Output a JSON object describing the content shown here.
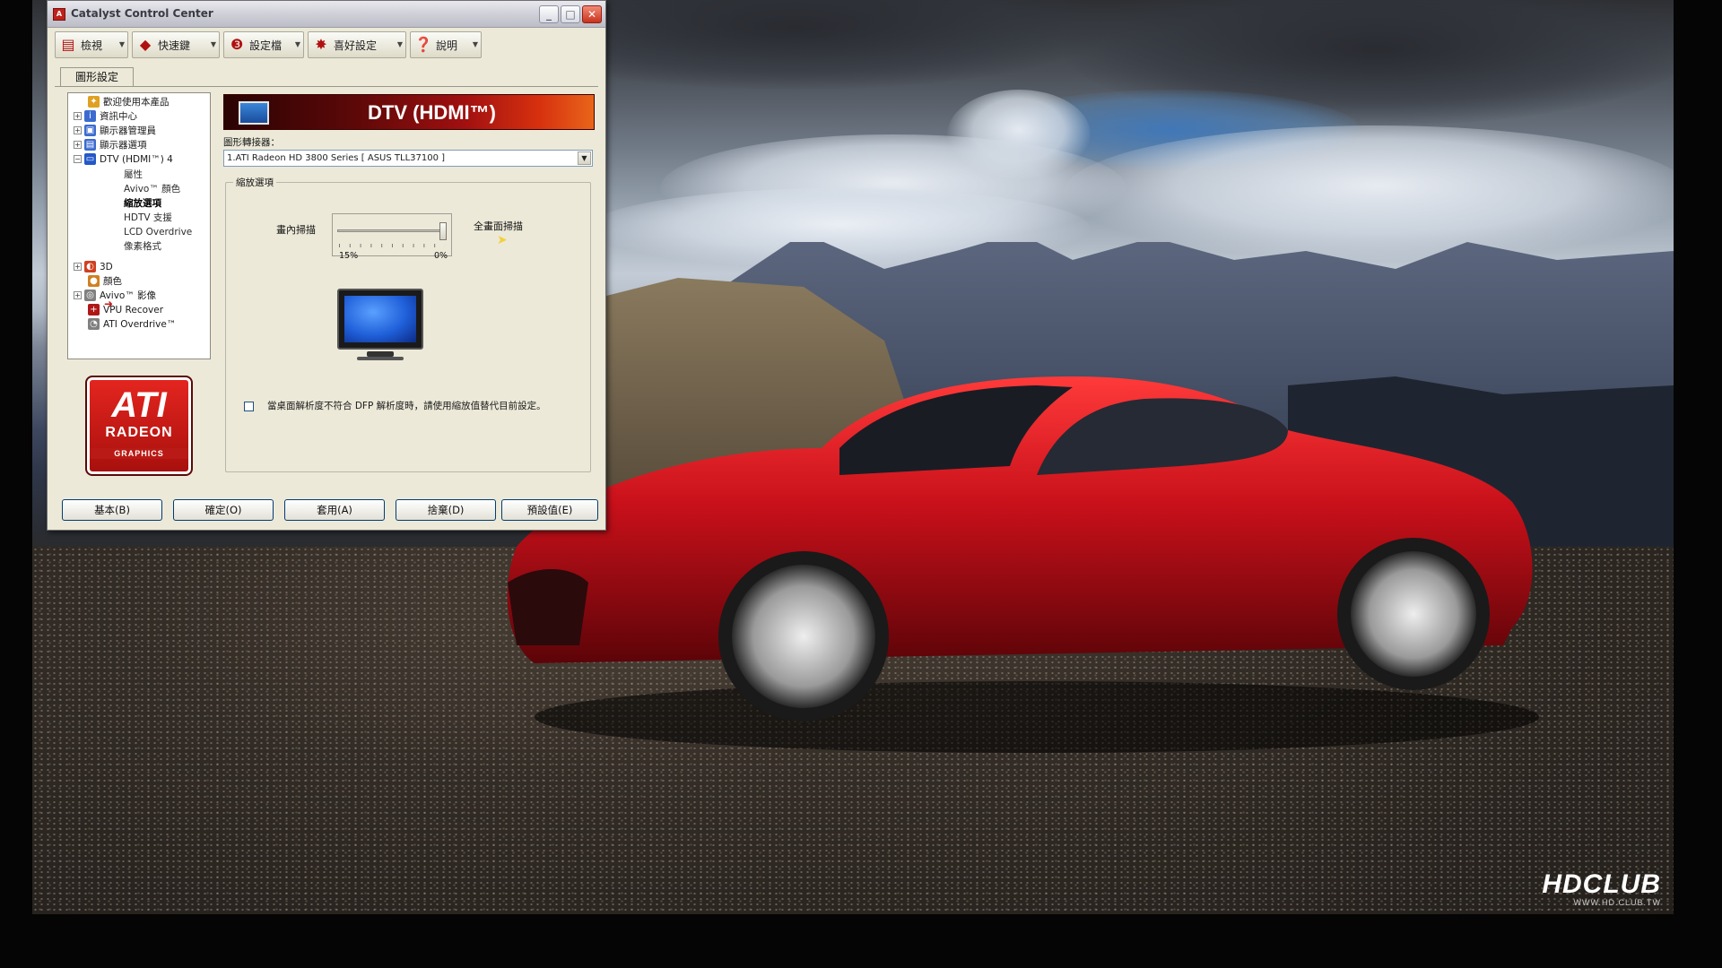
{
  "window": {
    "title": "Catalyst Control Center",
    "minimize": "_",
    "maximize": "□",
    "close": "✕"
  },
  "toolbar": {
    "items": [
      {
        "label": "檢視",
        "icon": "view-icon"
      },
      {
        "label": "快速鍵",
        "icon": "hotkeys-icon"
      },
      {
        "label": "設定檔",
        "icon": "profiles-icon"
      },
      {
        "label": "喜好設定",
        "icon": "preferences-icon"
      },
      {
        "label": "說明",
        "icon": "help-icon"
      }
    ]
  },
  "tabs": {
    "graphics": "圖形設定"
  },
  "tree": {
    "items": [
      {
        "label": "歡迎使用本產品",
        "color": "#e0a020"
      },
      {
        "label": "資訊中心",
        "color": "#3b6bd0"
      },
      {
        "label": "顯示器管理員",
        "color": "#3b6bd0"
      },
      {
        "label": "顯示器選項",
        "color": "#3b6bd0"
      },
      {
        "label": "DTV (HDMI™) 4",
        "color": "#2458c8"
      },
      {
        "label": "屬性"
      },
      {
        "label": "Avivo™ 顏色"
      },
      {
        "label": "縮放選項"
      },
      {
        "label": "HDTV 支援"
      },
      {
        "label": "LCD Overdrive"
      },
      {
        "label": "像素格式"
      },
      {
        "label": "3D",
        "color": "#d04020"
      },
      {
        "label": "顏色",
        "color": "#d08020"
      },
      {
        "label": "Avivo™ 影像",
        "color": "#808080"
      },
      {
        "label": "VPU Recover",
        "color": "#b01818"
      },
      {
        "label": "ATI Overdrive™",
        "color": "#808080"
      }
    ],
    "pointer": "➜"
  },
  "logo": {
    "line1": "ATI",
    "line2": "RADEON",
    "line3": "GRAPHICS"
  },
  "content": {
    "banner_title": "DTV (HDMI™)",
    "adapter_label": "圖形轉接器：",
    "adapter_value": "1.ATI Radeon HD 3800 Series [ ASUS TLL37100 ]",
    "dropdown_arrow": "▼",
    "group_title": "縮放選項",
    "underscan_label": "畫內掃描",
    "overscan_label": "全畫面掃描",
    "slider_min": "15%",
    "slider_max": "0%",
    "slider_value_fraction": 1.0,
    "checkbox_text": "當桌面解析度不符合 DFP 解析度時，請使用縮放值替代目前設定。",
    "checkbox_checked": false
  },
  "buttons": {
    "basic": "基本(B)",
    "ok": "確定(O)",
    "apply": "套用(A)",
    "discard": "捨棄(D)",
    "defaults": "預設值(E)"
  },
  "watermark": {
    "logo": "HDCLUB",
    "url": "WWW.HD.CLUB.TW"
  }
}
